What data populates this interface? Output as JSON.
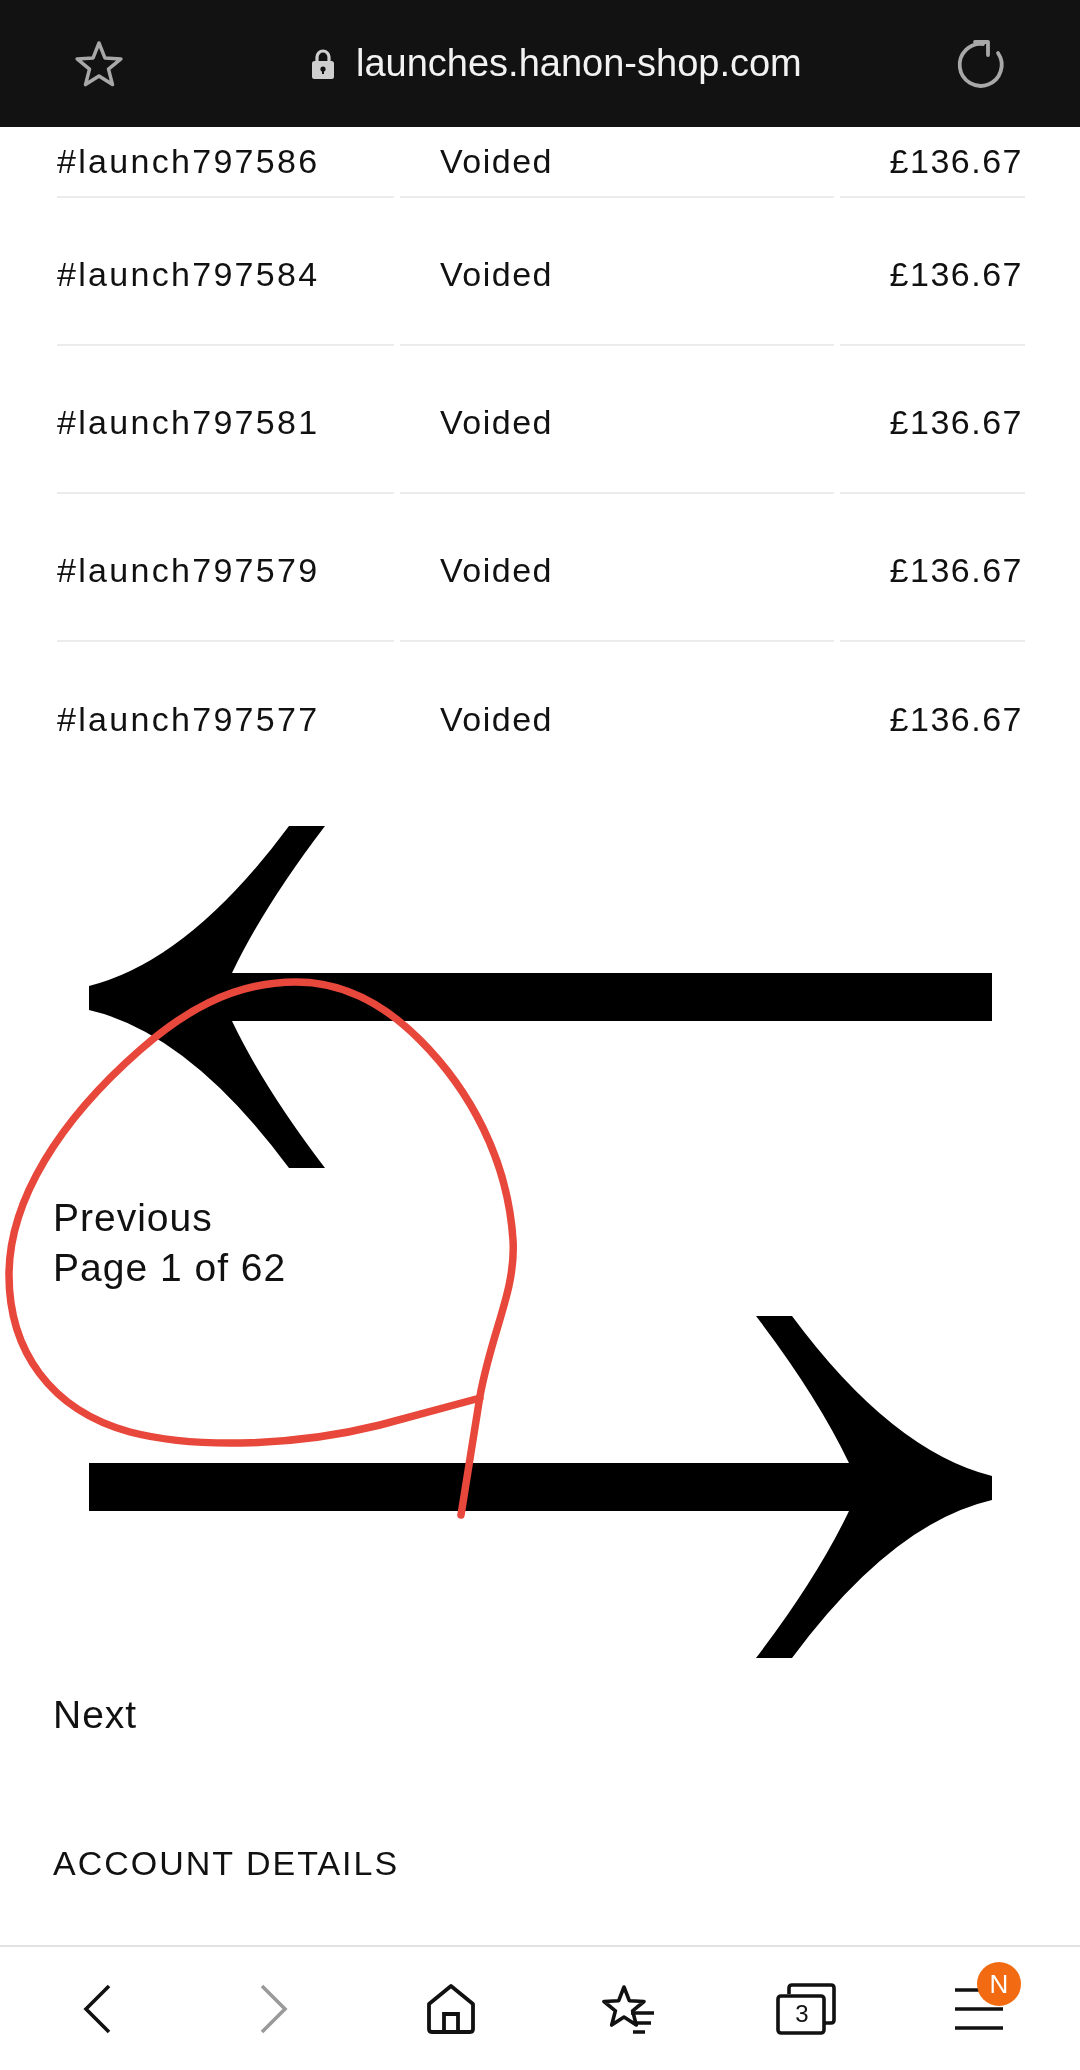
{
  "browser_bar": {
    "url": "launches.hanon-shop.com"
  },
  "orders_table": {
    "rows": [
      {
        "column_1": "#launch797586",
        "column_2": "Voided",
        "column_3": "£136.67"
      },
      {
        "column_1": "#launch797584",
        "column_2": "Voided",
        "column_3": "£136.67"
      },
      {
        "column_1": "#launch797581",
        "column_2": "Voided",
        "column_3": "£136.67"
      },
      {
        "column_1": "#launch797579",
        "column_2": "Voided",
        "column_3": "£136.67"
      },
      {
        "column_1": "#launch797577",
        "column_2": "Voided",
        "column_3": "£136.67"
      }
    ]
  },
  "pagination": {
    "previous": "Previous",
    "page_info": "Page 1 of 62",
    "next": "Next"
  },
  "account_section": {
    "title": "ACCOUNT DETAILS"
  },
  "bottom_nav": {
    "items": [
      {
        "kind": "back",
        "disabled": false
      },
      {
        "kind": "forward",
        "disabled": true
      },
      {
        "kind": "home",
        "disabled": false
      },
      {
        "kind": "bookmarks",
        "disabled": false
      },
      {
        "kind": "tabs",
        "disabled": false,
        "count": "3"
      },
      {
        "kind": "menu",
        "disabled": false,
        "badge": "N"
      }
    ]
  }
}
